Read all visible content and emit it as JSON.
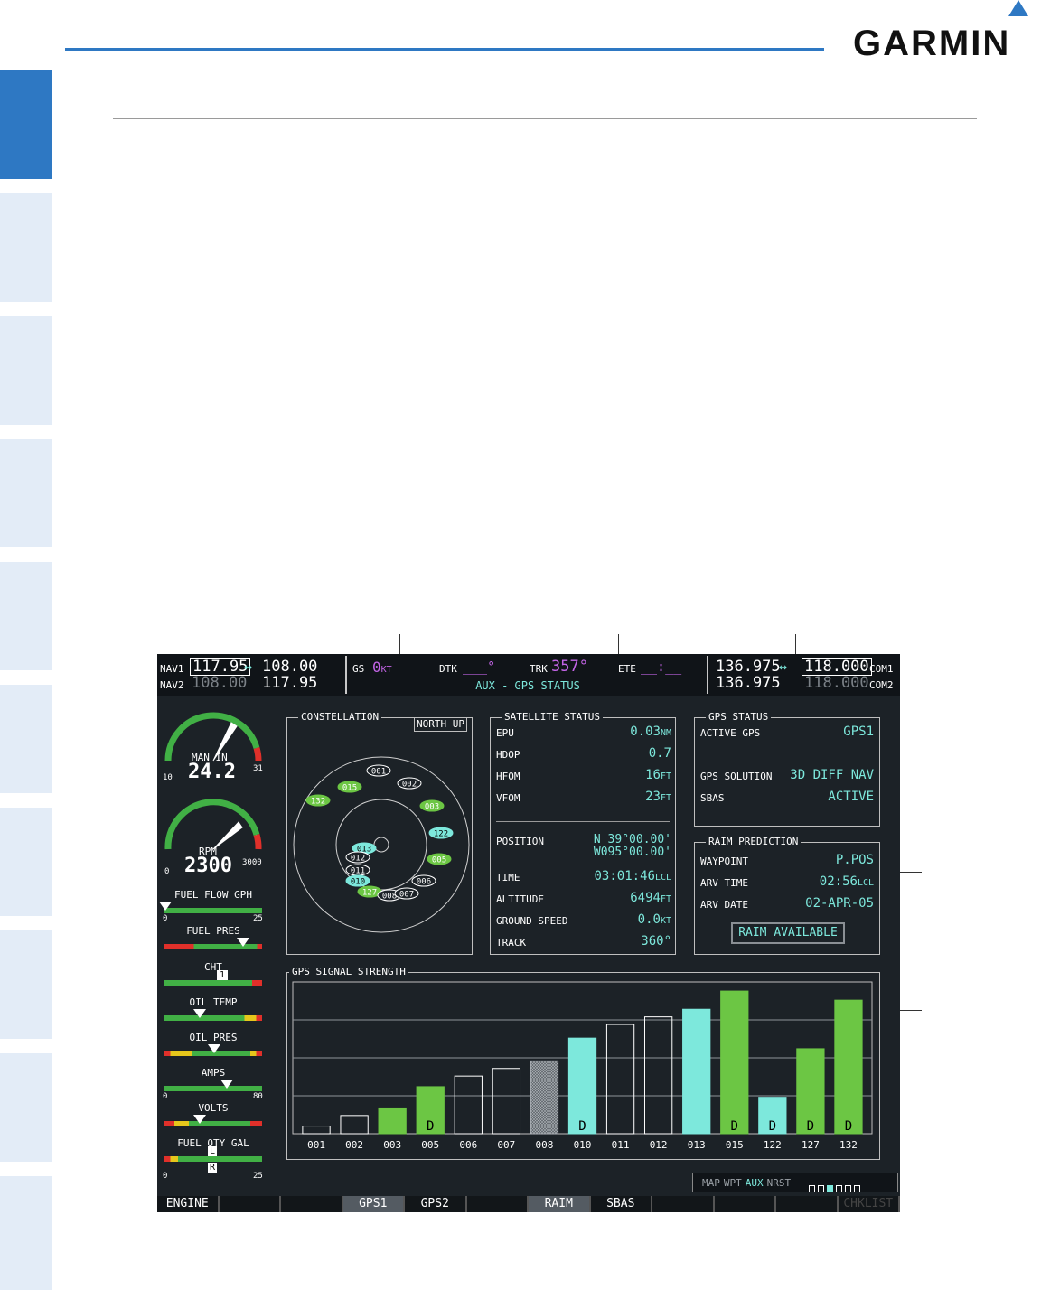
{
  "brand": {
    "logo_text": "GARMIN"
  },
  "colors": {
    "accent": "#2e78c3",
    "tab_inactive": "#e3ecf7",
    "display_bg": "#1c2227",
    "cyan": "#7de8dc",
    "green": "#6cc644",
    "magenta": "#c364e6"
  },
  "top_bar": {
    "nav1_label": "NAV1",
    "nav1_active": "117.95",
    "nav1_arrow": "↔",
    "nav1_standby": "108.00",
    "nav2_label": "NAV2",
    "nav2_active": "108.00",
    "nav2_standby": "117.95",
    "gs_label": "GS",
    "gs_value": "0",
    "gs_unit": "KT",
    "dtk_label": "DTK",
    "dtk_value": "___°",
    "trk_label": "TRK",
    "trk_value": "357°",
    "ete_label": "ETE",
    "ete_value": "__:__",
    "page_title": "AUX - GPS STATUS",
    "com1_standby": "136.975",
    "com1_arrow": "↔",
    "com1_active": "118.000",
    "com1_label": "COM1",
    "com2_standby": "136.975",
    "com2_active": "118.000",
    "com2_label": "COM2"
  },
  "engine": {
    "man_in_label": "MAN IN",
    "man_in_value": "24.2",
    "man_in_min": "10",
    "man_in_max": "31",
    "rpm_label": "RPM",
    "rpm_value": "2300",
    "rpm_min": "0",
    "rpm_max": "3000",
    "fuel_flow_label": "FUEL FLOW GPH",
    "fuel_flow_min": "0",
    "fuel_flow_max": "25",
    "fuel_pres_label": "FUEL PRES",
    "cht_label": "CHT",
    "cht_cyl": "1",
    "oil_temp_label": "OIL TEMP",
    "oil_pres_label": "OIL PRES",
    "amps_label": "AMPS",
    "amps_min": "0",
    "amps_max": "80",
    "volts_label": "VOLTS",
    "fuel_qty_label": "FUEL QTY GAL",
    "fuel_qty_min": "0",
    "fuel_qty_max": "25",
    "fuel_qty_left": "L",
    "fuel_qty_right": "R"
  },
  "constellation": {
    "title": "CONSTELLATION",
    "orientation": "NORTH UP",
    "satellites": [
      {
        "id": "001",
        "style": "outline"
      },
      {
        "id": "002",
        "style": "outline"
      },
      {
        "id": "003",
        "style": "green"
      },
      {
        "id": "015",
        "style": "green"
      },
      {
        "id": "132",
        "style": "green"
      },
      {
        "id": "122",
        "style": "cyan"
      },
      {
        "id": "005",
        "style": "green"
      },
      {
        "id": "006",
        "style": "outline"
      },
      {
        "id": "013",
        "style": "cyan"
      },
      {
        "id": "012",
        "style": "outline"
      },
      {
        "id": "011",
        "style": "outline"
      },
      {
        "id": "010",
        "style": "cyan"
      },
      {
        "id": "127",
        "style": "green"
      },
      {
        "id": "008",
        "style": "outline"
      },
      {
        "id": "007",
        "style": "outline"
      }
    ]
  },
  "satellite_status": {
    "title": "SATELLITE STATUS",
    "epu_label": "EPU",
    "epu_value": "0.03",
    "epu_unit": "NM",
    "hdop_label": "HDOP",
    "hdop_value": "0.7",
    "hfom_label": "HFOM",
    "hfom_value": "16",
    "hfom_unit": "FT",
    "vfom_label": "VFOM",
    "vfom_value": "23",
    "vfom_unit": "FT",
    "position_label": "POSITION",
    "lat": "N 39°00.00'",
    "lon": "W095°00.00'",
    "time_label": "TIME",
    "time_value": "03:01:46",
    "time_unit": "LCL",
    "altitude_label": "ALTITUDE",
    "altitude_value": "6494",
    "altitude_unit": "FT",
    "ground_speed_label": "GROUND SPEED",
    "ground_speed_value": "0.0",
    "ground_speed_unit": "KT",
    "track_label": "TRACK",
    "track_value": "360°"
  },
  "gps_status": {
    "title": "GPS STATUS",
    "active_gps_label": "ACTIVE GPS",
    "active_gps_value": "GPS1",
    "solution_label": "GPS SOLUTION",
    "solution_value": "3D DIFF NAV",
    "sbas_label": "SBAS",
    "sbas_value": "ACTIVE"
  },
  "raim": {
    "title": "RAIM PREDICTION",
    "waypoint_label": "WAYPOINT",
    "waypoint_value": "P.POS",
    "arv_time_label": "ARV TIME",
    "arv_time_value": "02:56",
    "arv_time_unit": "LCL",
    "arv_date_label": "ARV DATE",
    "arv_date_value": "02-APR-05",
    "status_button": "RAIM AVAILABLE"
  },
  "signal_strength": {
    "title": "GPS SIGNAL STRENGTH"
  },
  "chart_data": {
    "type": "bar",
    "title": "GPS SIGNAL STRENGTH",
    "categories": [
      "001",
      "002",
      "003",
      "005",
      "006",
      "007",
      "008",
      "010",
      "011",
      "012",
      "013",
      "015",
      "122",
      "127",
      "132"
    ],
    "values": [
      0.05,
      0.12,
      0.17,
      0.31,
      0.38,
      0.43,
      0.48,
      0.63,
      0.72,
      0.77,
      0.82,
      0.94,
      0.24,
      0.56,
      0.88
    ],
    "styles": [
      "outline",
      "outline",
      "green",
      "green",
      "outline",
      "outline",
      "hatched",
      "cyan",
      "outline",
      "outline",
      "cyan",
      "green",
      "cyan",
      "green",
      "green"
    ],
    "flags": [
      "",
      "",
      "",
      "D",
      "",
      "",
      "",
      "D",
      "",
      "",
      "",
      "D",
      "D",
      "D",
      "D"
    ],
    "ylim": [
      0,
      1
    ],
    "grid": true
  },
  "page_group": {
    "items": [
      "MAP",
      "WPT",
      "AUX",
      "NRST"
    ],
    "active": "AUX"
  },
  "softkeys": [
    {
      "label": "ENGINE",
      "state": "normal"
    },
    {
      "label": "",
      "state": "normal"
    },
    {
      "label": "",
      "state": "normal"
    },
    {
      "label": "GPS1",
      "state": "lit"
    },
    {
      "label": "GPS2",
      "state": "normal"
    },
    {
      "label": "",
      "state": "normal"
    },
    {
      "label": "RAIM",
      "state": "lit"
    },
    {
      "label": "SBAS",
      "state": "normal"
    },
    {
      "label": "",
      "state": "normal"
    },
    {
      "label": "",
      "state": "normal"
    },
    {
      "label": "",
      "state": "normal"
    },
    {
      "label": "CHKLIST",
      "state": "dim"
    }
  ]
}
